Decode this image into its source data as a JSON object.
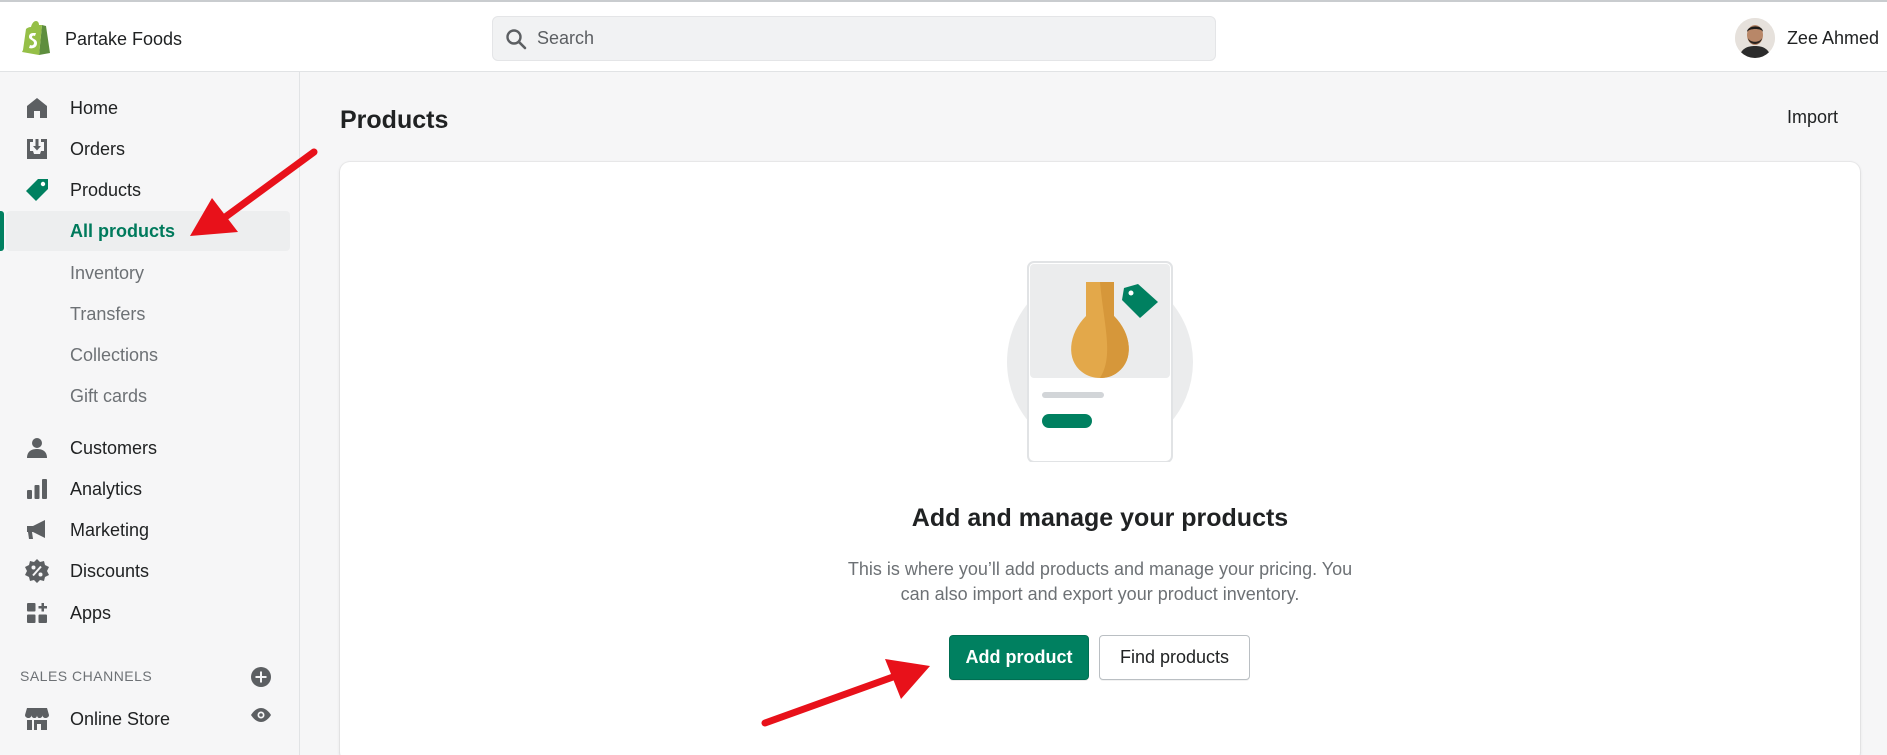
{
  "topbar": {
    "store_name": "Partake Foods",
    "search_placeholder": "Search",
    "user_name": "Zee Ahmed"
  },
  "sidebar": {
    "items": [
      {
        "label": "Home",
        "icon": "home-icon"
      },
      {
        "label": "Orders",
        "icon": "orders-icon"
      },
      {
        "label": "Products",
        "icon": "tag-icon"
      },
      {
        "label": "Customers",
        "icon": "person-icon"
      },
      {
        "label": "Analytics",
        "icon": "bar-chart-icon"
      },
      {
        "label": "Marketing",
        "icon": "megaphone-icon"
      },
      {
        "label": "Discounts",
        "icon": "discount-icon"
      },
      {
        "label": "Apps",
        "icon": "apps-icon"
      }
    ],
    "product_subitems": [
      "All products",
      "Inventory",
      "Transfers",
      "Collections",
      "Gift cards"
    ],
    "active_subitem": "All products",
    "sales_channels_title": "SALES CHANNELS",
    "online_store": "Online Store"
  },
  "main": {
    "title": "Products",
    "import_label": "Import",
    "empty_state": {
      "heading": "Add and manage your products",
      "description": "This is where you’ll add products and manage your pricing. You can also import and export your product inventory.",
      "primary_action": "Add product",
      "secondary_action": "Find products"
    }
  },
  "colors": {
    "accent": "#008060",
    "annotation_arrow": "#e8111a"
  }
}
